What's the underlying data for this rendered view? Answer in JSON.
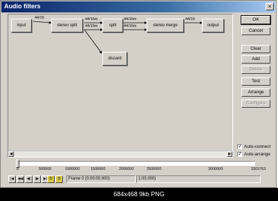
{
  "window": {
    "title": "Audio filters"
  },
  "graph": {
    "nodes": {
      "input": "input",
      "stereo_split": "stereo split",
      "split": "split",
      "stereo_merge": "stereo merge",
      "output": "output",
      "discard": "discard"
    },
    "pins": {
      "input_out": "44/16",
      "split_out1": "44/16m",
      "split_out2": "44/16m",
      "splt_out1": "44/16m",
      "splt_out2": "44/16m",
      "merge_out": "44/16"
    }
  },
  "buttons": {
    "ok": "OK",
    "cancel": "Cancel",
    "clear": "Clear",
    "add": "Add",
    "delete": "Delete",
    "test": "Test",
    "arrange": "Arrange",
    "configure": "Configure"
  },
  "checkboxes": {
    "auto_connect": "Auto-connect",
    "auto_arrange": "Auto-arrange"
  },
  "timeline": {
    "ticks": [
      "0",
      "500000",
      "1000000",
      "1500000",
      "2000000",
      "2500000",
      "3000000",
      "3303763"
    ],
    "position_fraction": 0.0
  },
  "status": {
    "frame": "Frame 0 (0:00:00.000)",
    "time": "1:00.000)"
  },
  "caption": "684x468  9kb  PNG",
  "icons": {
    "stop": "stop-icon",
    "start": "start-icon",
    "prev": "prev-frame-icon",
    "next": "next-frame-icon",
    "end": "end-icon",
    "key_prev": "key-prev-icon",
    "key_next": "key-next-icon"
  }
}
